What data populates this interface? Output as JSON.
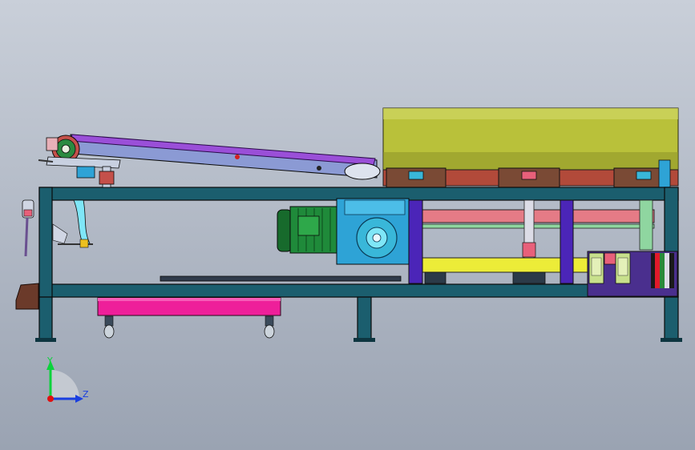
{
  "viewport": {
    "background_top": "#c9cfd9",
    "background_bottom": "#9aa3b2"
  },
  "colors": {
    "frame": "#1b5e6e",
    "frame_edge": "#0a0a0a",
    "conveyor_belt": "#9a4fd8",
    "drum_tank": "#b9c13a",
    "motor": "#1f8a3a",
    "gearbox": "#2ea3d6",
    "pink_tray": "#ee1f9a",
    "purple_post": "#4b25b8",
    "yellow_rail": "#ecec38",
    "salmon_rail": "#e57b86",
    "mint_rail": "#8fd6a0",
    "control_panel": "#4a2f8e",
    "brown_mount": "#6b3a2a",
    "axis_x": "#e01010",
    "axis_y": "#0cd23c",
    "axis_z": "#1a3fe0"
  },
  "triad": {
    "y_label": "Y",
    "z_label": "Z",
    "x_icon": "axis-x-arrow-icon"
  }
}
